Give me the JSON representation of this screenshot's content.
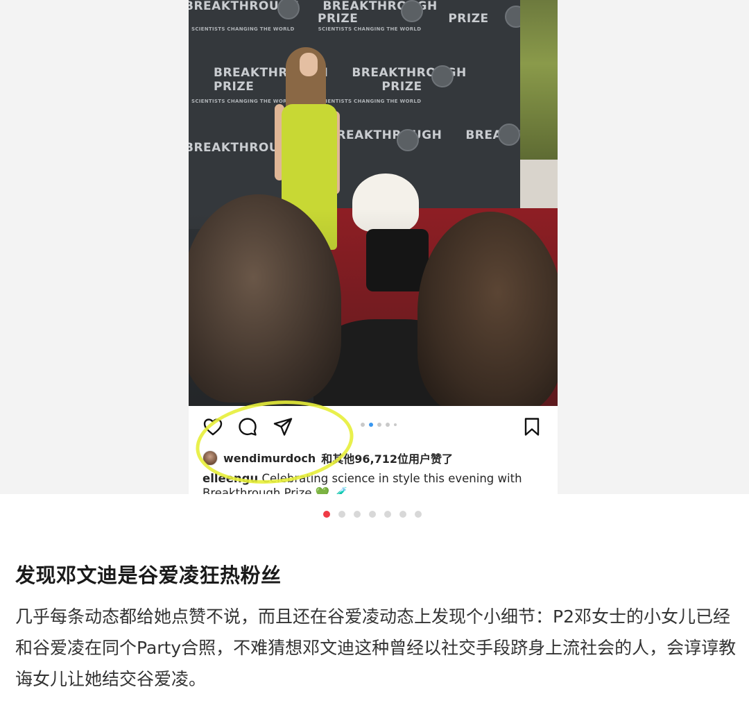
{
  "carousel_image": {
    "backdrop_brand_big": "BREAKTHROUGH",
    "backdrop_brand_big2": "PRIZE",
    "backdrop_tagline": "SCIENTISTS CHANGING THE WORLD"
  },
  "instagram": {
    "icons": {
      "like": "heart-icon",
      "comment": "comment-bubble-icon",
      "share": "paper-plane-icon",
      "save": "bookmark-icon"
    },
    "image_dots": 5,
    "image_dots_active_index": 1,
    "likes_user": "wendimurdoch",
    "likes_text": "和其他96,712位用户赞了",
    "caption_user": "elleengu",
    "caption_text": " Celebrating science in style this evening with",
    "caption_line2": "Breakthrough Prize 💚 🧪",
    "highlight_color": "#e7ee3a"
  },
  "pager": {
    "count": 7,
    "active_index": 0,
    "active_color": "#ef3b46"
  },
  "post": {
    "title": "发现邓文迪是谷爱凌狂热粉丝",
    "body": "几乎每条动态都给她点赞不说，而且还在谷爱凌动态上发现个小细节：P2邓女士的小女儿已经和谷爱凌在同个Party合照，不难猜想邓文迪这种曾经以社交手段跻身上流社会的人，会谆谆教诲女儿让她结交谷爱凌。"
  }
}
